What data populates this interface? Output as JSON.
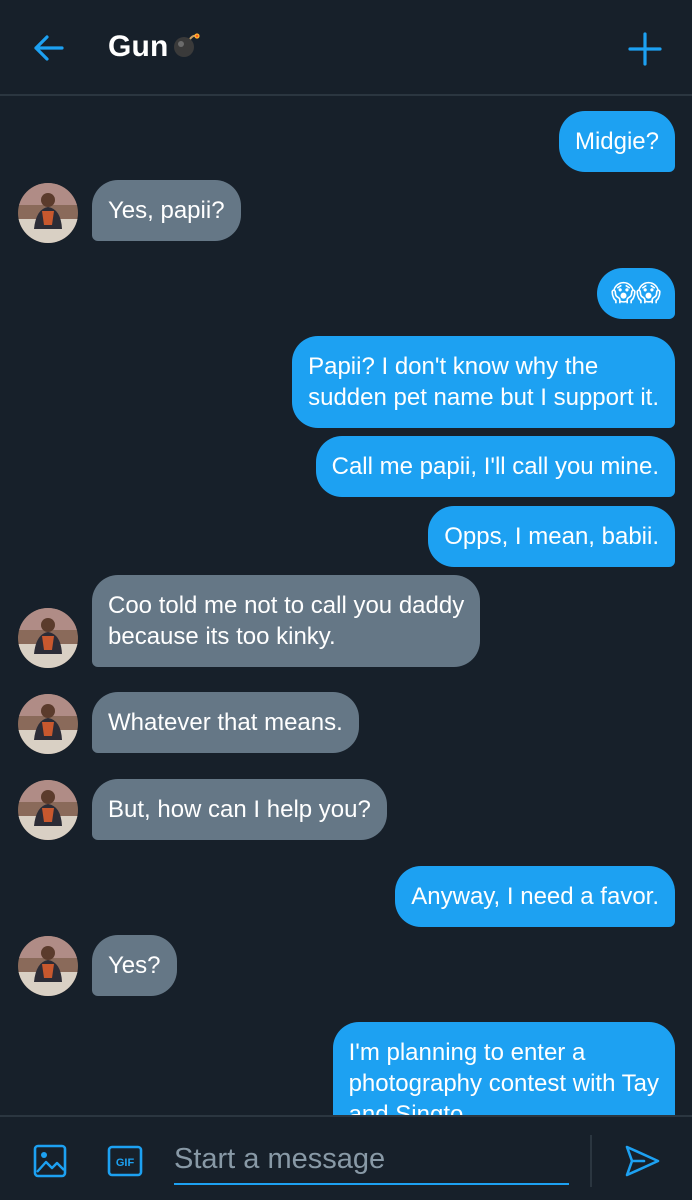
{
  "header": {
    "title": "Gun"
  },
  "messages": [
    {
      "from": "me",
      "text": "Midgie?"
    },
    {
      "from": "them",
      "text": "Yes, papii?"
    },
    {
      "from": "me",
      "text": "😱😱"
    },
    {
      "from": "me",
      "lines": [
        "Papii? I don't know why the",
        "sudden pet name but I support it."
      ]
    },
    {
      "from": "me",
      "text": "Call me papii, I'll call you mine."
    },
    {
      "from": "me",
      "text": "Opps, I mean, babii."
    },
    {
      "from": "them",
      "lines": [
        "Coo told me not to call you daddy",
        "because its too kinky."
      ]
    },
    {
      "from": "them",
      "text": "Whatever that means."
    },
    {
      "from": "them",
      "text": "But, how can I help you?"
    },
    {
      "from": "me",
      "text": "Anyway, I need a favor."
    },
    {
      "from": "them",
      "text": "Yes?"
    },
    {
      "from": "me",
      "lines": [
        "I'm planning to enter a",
        "photography contest with Tay",
        "and Singto"
      ]
    }
  ],
  "composer": {
    "placeholder": "Start a message",
    "gif_label": "GIF"
  },
  "icons": {
    "back": "arrow-left-icon",
    "title_emoji": "bomb-icon",
    "new": "plus-icon",
    "image": "image-icon",
    "gif": "gif-icon",
    "send": "send-icon"
  },
  "colors": {
    "background": "#17202a",
    "accent": "#1da1f2",
    "outgoing_bubble": "#1da1f2",
    "incoming_bubble": "#657786",
    "placeholder": "#8899a6"
  }
}
